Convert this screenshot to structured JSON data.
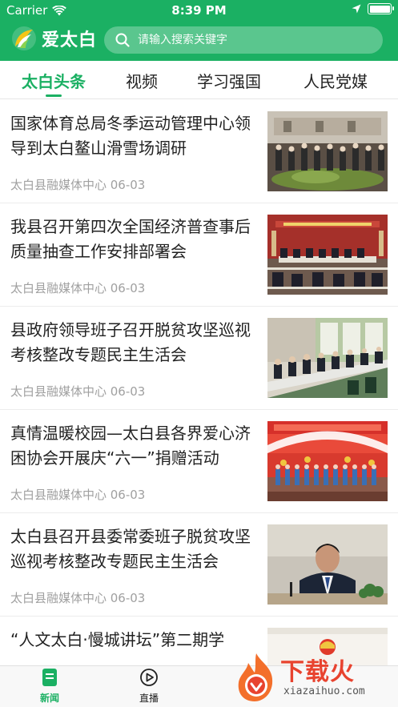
{
  "status_bar": {
    "carrier": "Carrier",
    "time": "8:39 PM",
    "wifi_icon": "wifi-icon",
    "location_icon": "location-arrow-icon",
    "battery_icon": "battery-icon"
  },
  "header": {
    "app_name": "爱太白",
    "search_placeholder": "请输入搜索关键字",
    "brand_color": "#1bb063"
  },
  "tabs": [
    {
      "label": "太白头条",
      "active": true
    },
    {
      "label": "视频",
      "active": false
    },
    {
      "label": "学习强国",
      "active": false
    },
    {
      "label": "人民党媒",
      "active": false
    }
  ],
  "news": [
    {
      "title": "国家体育总局冬季运动管理中心领导到太白鳌山滑雪场调研",
      "source": "太白县融媒体中心",
      "date": "06-03",
      "meta": "太白县融媒体中心  06-03"
    },
    {
      "title": "我县召开第四次全国经济普查事后质量抽查工作安排部署会",
      "source": "太白县融媒体中心",
      "date": "06-03",
      "meta": "太白县融媒体中心  06-03"
    },
    {
      "title": "县政府领导班子召开脱贫攻坚巡视考核整改专题民主生活会",
      "source": "太白县融媒体中心",
      "date": "06-03",
      "meta": "太白县融媒体中心  06-03"
    },
    {
      "title": "真情温暖校园—太白县各界爱心济困协会开展庆“六一”捐赠活动",
      "source": "太白县融媒体中心",
      "date": "06-03",
      "meta": "太白县融媒体中心  06-03"
    },
    {
      "title": "太白县召开县委常委班子脱贫攻坚巡视考核整改专题民主生活会",
      "source": "太白县融媒体中心",
      "date": "06-03",
      "meta": "太白县融媒体中心  06-03"
    },
    {
      "title": "“人文太白·慢城讲坛”第二期学",
      "source": "",
      "date": "",
      "meta": ""
    }
  ],
  "bottom_nav": [
    {
      "label": "新闻",
      "icon": "news-icon",
      "active": true
    },
    {
      "label": "直播",
      "icon": "play-circle-icon",
      "active": false
    }
  ],
  "watermark": {
    "text": "下载火",
    "url": "xiazaihuo.com"
  }
}
